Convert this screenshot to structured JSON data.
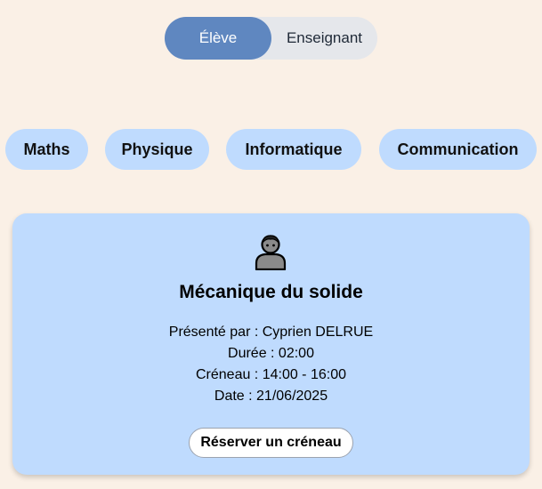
{
  "role_toggle": {
    "options": [
      {
        "label": "Élève",
        "active": true
      },
      {
        "label": "Enseignant",
        "active": false
      }
    ]
  },
  "subjects": [
    {
      "label": "Maths"
    },
    {
      "label": "Physique"
    },
    {
      "label": "Informatique"
    },
    {
      "label": "Communication"
    }
  ],
  "course": {
    "icon": "person-icon",
    "title": "Mécanique du solide",
    "presenter": "Présenté par : Cyprien DELRUE",
    "duration": "Durée : 02:00",
    "slot": "Créneau : 14:00 - 16:00",
    "date": "Date : 21/06/2025",
    "book_label": "Réserver un créneau"
  },
  "colors": {
    "background": "#faf0e6",
    "toggle_active": "#5f87c0",
    "toggle_track": "#e5e7eb",
    "pill": "#bfdbfe",
    "card": "#bfdbfe"
  }
}
